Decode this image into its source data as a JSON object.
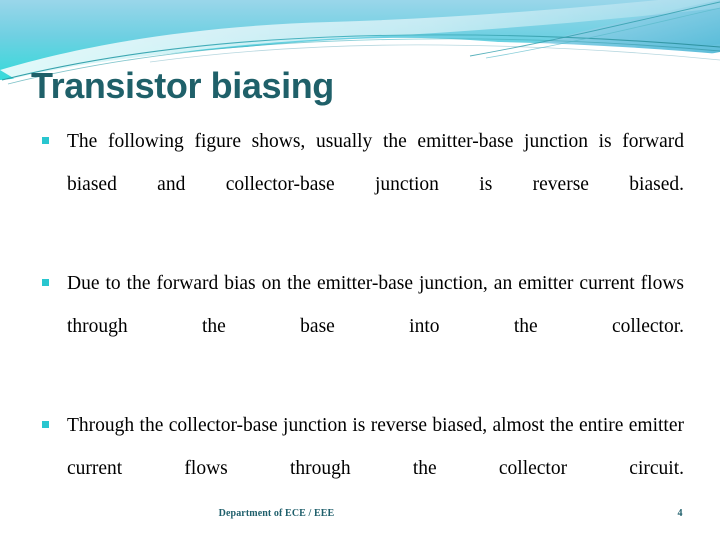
{
  "slide": {
    "title": "Transistor biasing",
    "background_color": "#ffffff",
    "title_color": "#1f6069",
    "accent_color": "#29c6cf",
    "body_text_color": "#000000"
  },
  "header": {
    "decoration_name": "flow-theme-swoosh",
    "gradient_top_color": "#8fd3e8",
    "gradient_bottom_color": "#3fd8da",
    "ribbon_color": "#7fd4e8",
    "line_color": "#2a8f98"
  },
  "body": {
    "bullets": [
      {
        "marker": "square-bullet",
        "text": "The following figure shows, usually the emitter-base junction is forward biased and collector-base junction is reverse biased."
      },
      {
        "marker": "square-bullet",
        "text": "Due to the forward bias on the emitter-base junction, an emitter current flows through the base into the collector."
      },
      {
        "marker": "square-bullet",
        "text": "Through the collector-base junction is reverse biased, almost the entire emitter current flows through the collector circuit."
      }
    ]
  },
  "footer": {
    "text": "Department of ECE / EEE",
    "page_number": "4",
    "color": "#1f5f6b"
  }
}
